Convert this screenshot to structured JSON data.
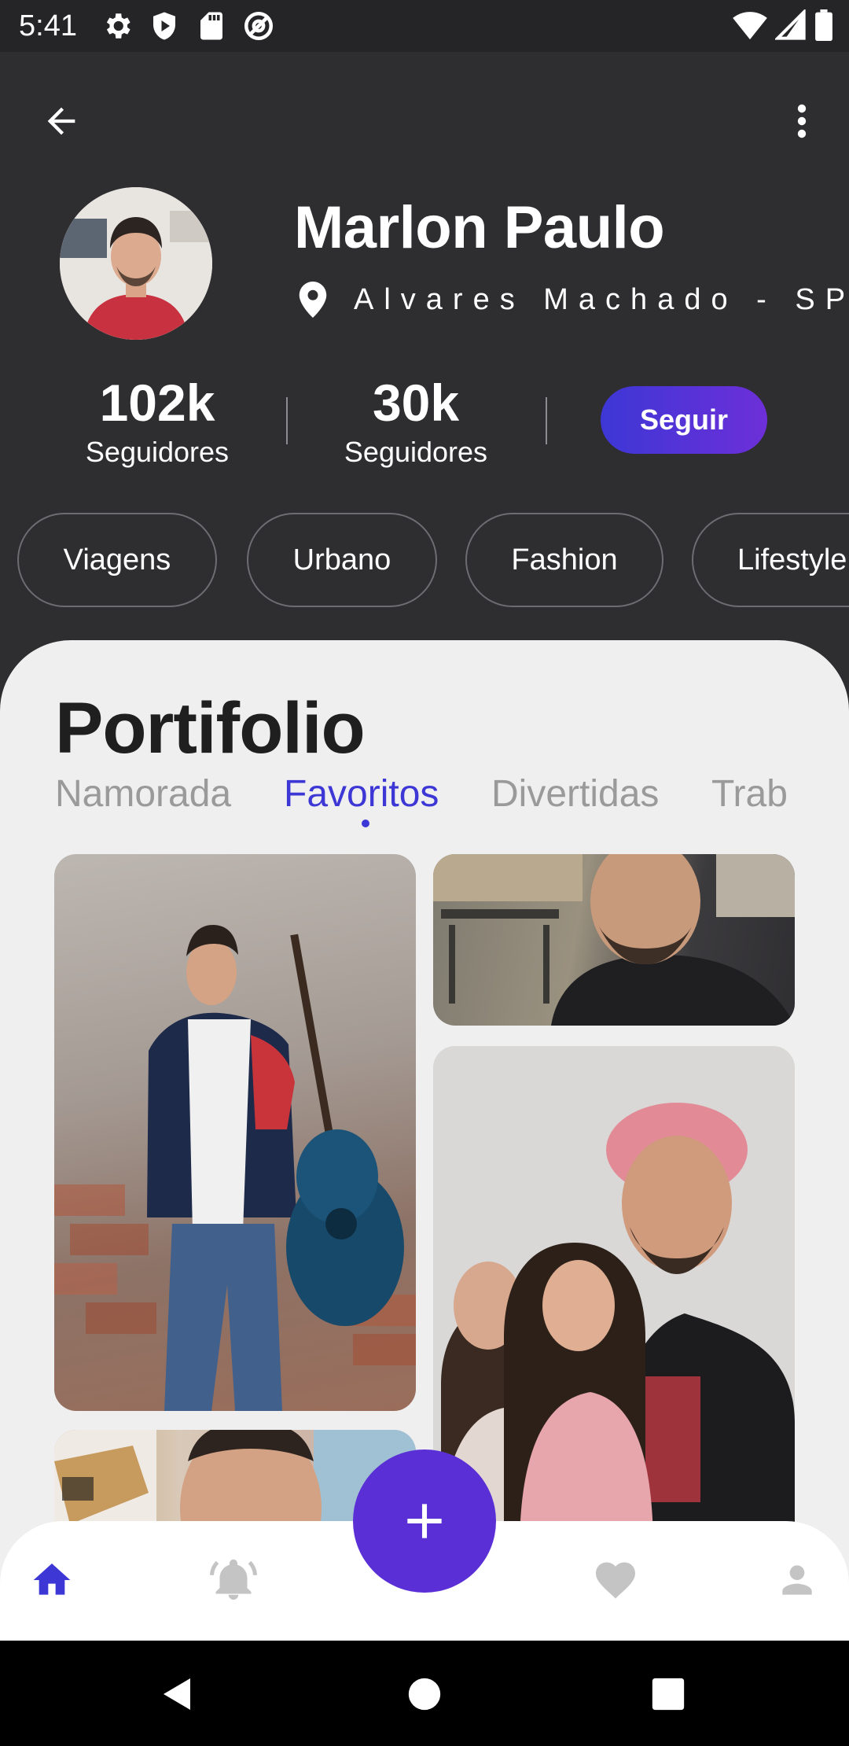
{
  "status_bar": {
    "time": "5:41",
    "icons": [
      "gear-icon",
      "shield-icon",
      "sd-card-icon",
      "at-sign-icon",
      "wifi-icon",
      "signal-icon",
      "battery-icon"
    ]
  },
  "app_bar": {
    "back_icon": "arrow-left-icon",
    "menu_icon": "more-vertical-icon"
  },
  "profile": {
    "name": "Marlon Paulo",
    "location": "Alvares Machado - SP",
    "stats": [
      {
        "value": "102k",
        "label": "Seguidores"
      },
      {
        "value": "30k",
        "label": "Seguidores"
      }
    ],
    "follow_label": "Seguir"
  },
  "chips": [
    "Viagens",
    "Urbano",
    "Fashion",
    "Lifestyle"
  ],
  "portfolio": {
    "title": "Portifolio",
    "tabs": [
      {
        "label": "Namorada",
        "active": false
      },
      {
        "label": "Favoritos",
        "active": true
      },
      {
        "label": "Divertidas",
        "active": false
      },
      {
        "label": "Trab",
        "active": false
      }
    ],
    "photos": [
      "photo-guitar",
      "photo-selfie-cafe",
      "photo-family",
      "photo-selfie-room"
    ]
  },
  "bottom_nav": {
    "items": [
      {
        "icon": "home-icon",
        "active": true
      },
      {
        "icon": "bell-icon",
        "active": false
      },
      {
        "icon": "heart-icon",
        "active": false
      },
      {
        "icon": "person-icon",
        "active": false
      }
    ],
    "fab_icon": "plus-icon"
  },
  "colors": {
    "accent": "#3d37d6",
    "fab": "#5b2fd6",
    "header_bg": "#2e2d30",
    "sheet_bg": "#efefef"
  }
}
